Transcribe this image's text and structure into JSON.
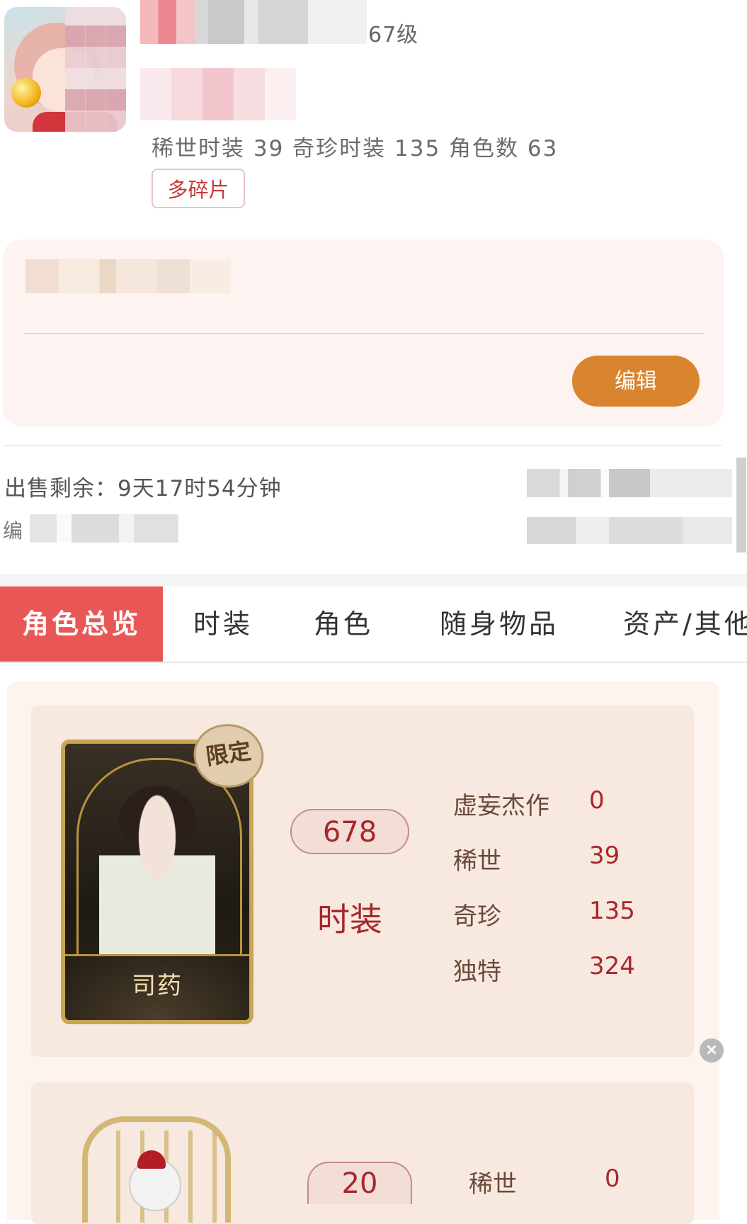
{
  "profile": {
    "level": "67级",
    "stats_line": "稀世时装 39 奇珍时装 135 角色数 63",
    "tag_label": "多碎片"
  },
  "description": {
    "edit_label": "编辑"
  },
  "sale": {
    "remaining": "出售剩余：9天17时54分钟",
    "id_prefix": "编"
  },
  "tabs": [
    {
      "label": "角色总览",
      "active": true
    },
    {
      "label": "时装",
      "active": false
    },
    {
      "label": "角色",
      "active": false
    },
    {
      "label": "随身物品",
      "active": false
    },
    {
      "label": "资产/其他",
      "active": false
    }
  ],
  "costume_summary": {
    "character_name": "司药",
    "badge": "限定",
    "count": "678",
    "label": "时装",
    "rows": [
      {
        "name": "虚妄杰作",
        "value": "0"
      },
      {
        "name": "稀世",
        "value": "39"
      },
      {
        "name": "奇珍",
        "value": "135"
      },
      {
        "name": "独特",
        "value": "324"
      }
    ]
  },
  "accessory_summary": {
    "count": "20",
    "rows": [
      {
        "name": "稀世",
        "value": "0"
      }
    ]
  },
  "colors": {
    "tab_active": "#e85656",
    "edit_button": "#d9842f",
    "value_red": "#a8272b"
  }
}
